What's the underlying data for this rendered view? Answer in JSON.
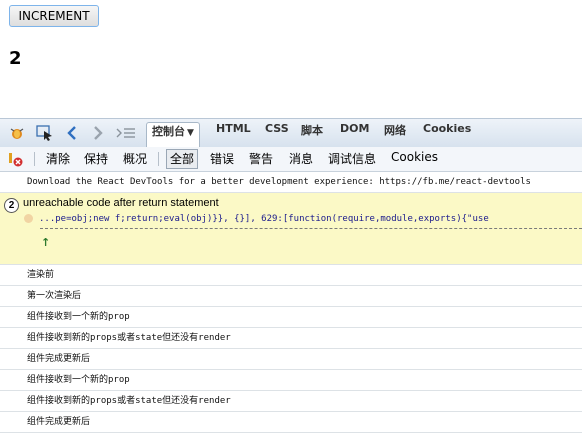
{
  "app": {
    "increment_label": "INCREMENT",
    "count": "2"
  },
  "devtools": {
    "icons": [
      "firebug-bug-icon",
      "inspect-icon",
      "back-icon",
      "forward-icon",
      "command-line-icon"
    ],
    "tabs": [
      {
        "label": "控制台",
        "active": true
      },
      {
        "label": "HTML"
      },
      {
        "label": "CSS"
      },
      {
        "label": "脚本"
      },
      {
        "label": "DOM"
      },
      {
        "label": "网络"
      },
      {
        "label": "Cookies"
      }
    ],
    "filter_bar": {
      "clear": "清除",
      "persist": "保持",
      "profile": "概况",
      "all": "全部",
      "errors": "错误",
      "warnings": "警告",
      "info": "消息",
      "debug": "调试信息",
      "cookies": "Cookies"
    },
    "log": {
      "react_hint": "Download the React DevTools for a better development experience: https://fb.me/react-devtools",
      "warning": {
        "count": "2",
        "message": "unreachable code after return statement",
        "source": "...pe=obj;new f;return;eval(obj)}}, {}], 629:[function(require,module,exports){\"use",
        "arrow": "↑"
      },
      "lines": [
        "渲染前",
        "第一次渲染后",
        "组件接收到一个新的prop",
        "组件接收到新的props或者state但还没有render",
        "组件完成更新后",
        "组件接收到一个新的prop",
        "组件接收到新的props或者state但还没有render",
        "组件完成更新后"
      ]
    }
  },
  "colors": {
    "warning_bg": "#fbf9c6",
    "toolbar_top": "#eef3f9",
    "button_border": "#7eb4ea"
  }
}
